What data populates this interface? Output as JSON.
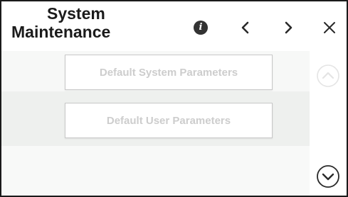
{
  "header": {
    "title_line1": "System",
    "title_line2": "Maintenance",
    "info_label": "i"
  },
  "buttons": {
    "default_system_parameters": "Default System Parameters",
    "default_user_parameters": "Default User Parameters"
  },
  "icons": {
    "info": "info-icon",
    "previous": "chevron-left-icon",
    "next": "chevron-right-icon",
    "close": "close-icon",
    "scroll_up": "chevron-up-circle-icon",
    "scroll_down": "chevron-down-circle-icon"
  },
  "colors": {
    "frame_border": "#1a1a1a",
    "title_text": "#1b1b1b",
    "disabled_button_text": "#cdcdcd",
    "content_band": "#eef0ee"
  }
}
